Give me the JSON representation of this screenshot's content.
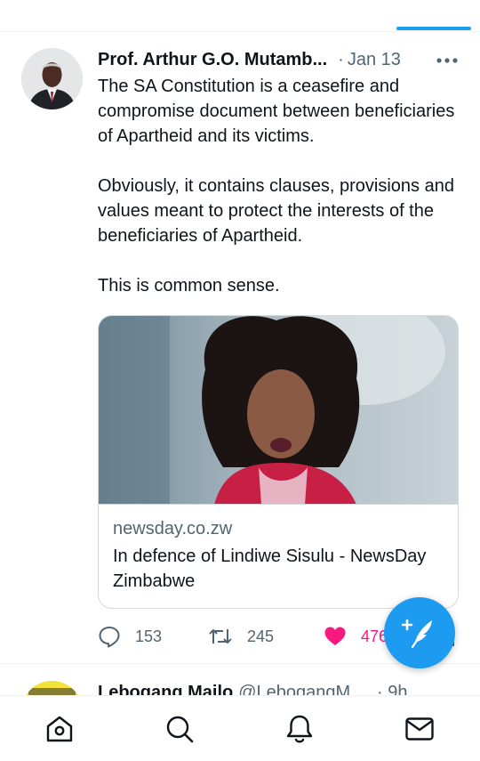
{
  "colors": {
    "accent": "#1d9bf0",
    "like": "#f91880",
    "secondary_text": "#536471",
    "primary_text": "#0f1419",
    "border": "#cfd9de"
  },
  "tweet": {
    "author_name": "Prof. Arthur G.O. Mutamb...",
    "separator": "·",
    "timestamp": "Jan 13",
    "more_icon": "more-horizontal-icon",
    "paragraphs": [
      "The SA Constitution is a ceasefire and compromise document between beneficiaries of Apartheid and its victims.",
      "Obviously, it contains clauses, provisions and values meant to protect the interests of the beneficiaries of Apartheid.",
      "This is common sense."
    ],
    "link_card": {
      "domain": "newsday.co.zw",
      "title": "In defence of Lindiwe Sisulu - NewsDay Zimbabwe"
    },
    "actions": {
      "reply_count": "153",
      "retweet_count": "245",
      "like_count": "476",
      "liked": true
    }
  },
  "compose_button": {
    "icon": "compose-feather-icon"
  },
  "next_tweet": {
    "author_name": "Lebogang Mailo",
    "handle": "@LebogangM...",
    "timestamp": "· 9h"
  },
  "bottom_nav": {
    "items": [
      {
        "icon": "home-icon"
      },
      {
        "icon": "search-icon"
      },
      {
        "icon": "notifications-bell-icon"
      },
      {
        "icon": "messages-envelope-icon"
      }
    ]
  }
}
